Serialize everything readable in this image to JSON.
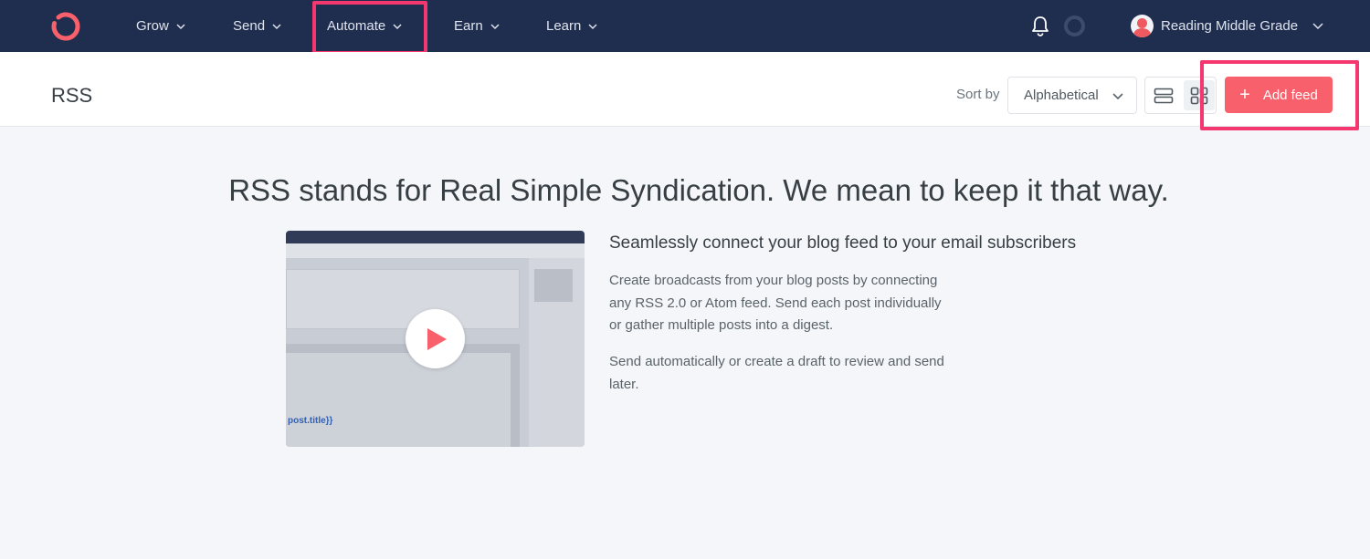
{
  "nav": {
    "items": [
      {
        "label": "Grow"
      },
      {
        "label": "Send"
      },
      {
        "label": "Automate"
      },
      {
        "label": "Earn"
      },
      {
        "label": "Learn"
      }
    ],
    "account_name": "Reading Middle Grade"
  },
  "header": {
    "title": "RSS",
    "sort_label": "Sort by",
    "sort_value": "Alphabetical",
    "add_button_label": "Add feed",
    "add_button_icon": "plus-icon"
  },
  "main": {
    "heading": "RSS stands for Real Simple Syndication. We mean to keep it that way.",
    "info_title": "Seamlessly connect your blog feed to your email subscribers",
    "info_paragraph_1": "Create broadcasts from your blog posts by connecting any RSS 2.0 or Atom feed. Send each post individually or gather multiple posts into a digest.",
    "info_paragraph_2": "Send automatically or create a draft to review and send later.",
    "video_fragment_text": "post.title}}"
  },
  "colors": {
    "nav_bg": "#1f2d4e",
    "accent": "#f8606b",
    "highlight": "#f4376e",
    "page_bg": "#f4f6f9"
  }
}
